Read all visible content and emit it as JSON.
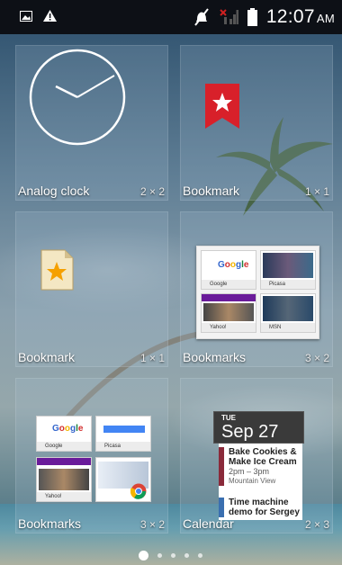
{
  "status_bar": {
    "time": "12:07",
    "ampm": "AM",
    "icons": [
      "gallery-notification-icon",
      "warning-icon",
      "mute-icon",
      "no-signal-icon",
      "battery-icon"
    ]
  },
  "widgets": [
    {
      "name": "Analog clock",
      "size": "2 × 2"
    },
    {
      "name": "Bookmark",
      "size": "1 × 1"
    },
    {
      "name": "Bookmark",
      "size": "1 × 1"
    },
    {
      "name": "Bookmarks",
      "size": "3 × 2"
    },
    {
      "name": "Bookmarks",
      "size": "3 × 2"
    },
    {
      "name": "Calendar",
      "size": "2 × 3"
    }
  ],
  "bookmark_thumbs": [
    {
      "title": "Google",
      "logo": "Google"
    },
    {
      "title": "Picasa",
      "logo": ""
    },
    {
      "title": "Yahoo!",
      "logo": ""
    },
    {
      "title": "MSN",
      "logo": ""
    }
  ],
  "bookmark_thumbs_small": [
    {
      "title": "Google",
      "logo": "Google"
    },
    {
      "title": "Picasa",
      "logo": ""
    },
    {
      "title": "Yahoo!",
      "logo": ""
    },
    {
      "title": "",
      "logo": ""
    }
  ],
  "calendar": {
    "day_of_week": "TUE",
    "date": "Sep 27",
    "events": [
      {
        "title": "Bake Cookies & Make Ice Cream",
        "time": "2pm – 3pm",
        "location": "Mountain View"
      },
      {
        "title": "Time machine demo for Sergey",
        "time": "",
        "location": ""
      }
    ]
  },
  "pager": {
    "pages": 5,
    "current": 0
  },
  "colors": {
    "status_bar": "#0d1016",
    "bookmark_red": "#d8202a",
    "calendar_accent": "#8a2a3a"
  }
}
